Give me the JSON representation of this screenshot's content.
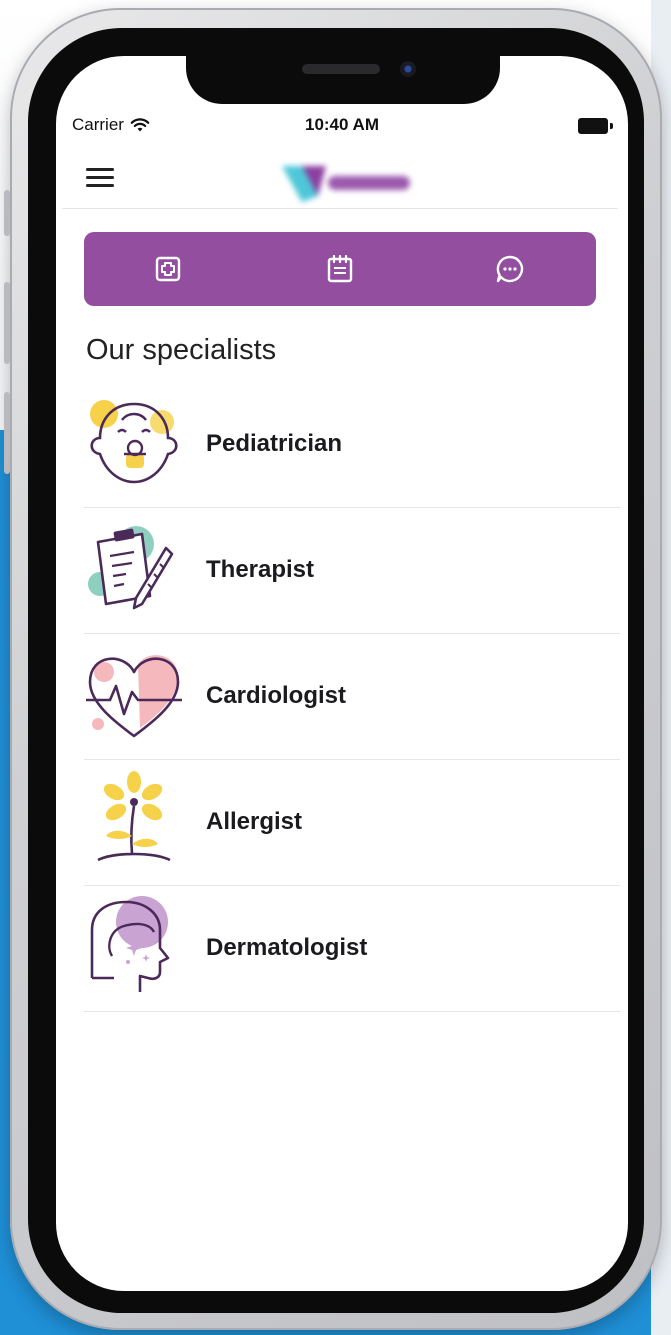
{
  "status_bar": {
    "carrier": "Carrier",
    "time": "10:40 AM"
  },
  "header": {
    "menu_icon": "hamburger-icon",
    "logo_icon": "brand-logo"
  },
  "tabs": [
    {
      "icon": "medical-cross-icon"
    },
    {
      "icon": "calendar-icon"
    },
    {
      "icon": "chat-bubble-icon"
    }
  ],
  "section_title": "Our specialists",
  "specialists": [
    {
      "label": "Pediatrician",
      "icon": "baby-face-icon"
    },
    {
      "label": "Therapist",
      "icon": "clipboard-thermometer-icon"
    },
    {
      "label": "Cardiologist",
      "icon": "heart-pulse-icon"
    },
    {
      "label": "Allergist",
      "icon": "flower-icon"
    },
    {
      "label": "Dermatologist",
      "icon": "face-profile-icon"
    }
  ],
  "colors": {
    "tab_bar": "#944ea0",
    "background_blue": "#1f8fd6",
    "accent_yellow": "#f6d24a",
    "accent_teal": "#8fcfbf",
    "accent_pink": "#f5b8bd",
    "accent_purple": "#c9a3d2",
    "line_purple": "#4b2a5a"
  }
}
